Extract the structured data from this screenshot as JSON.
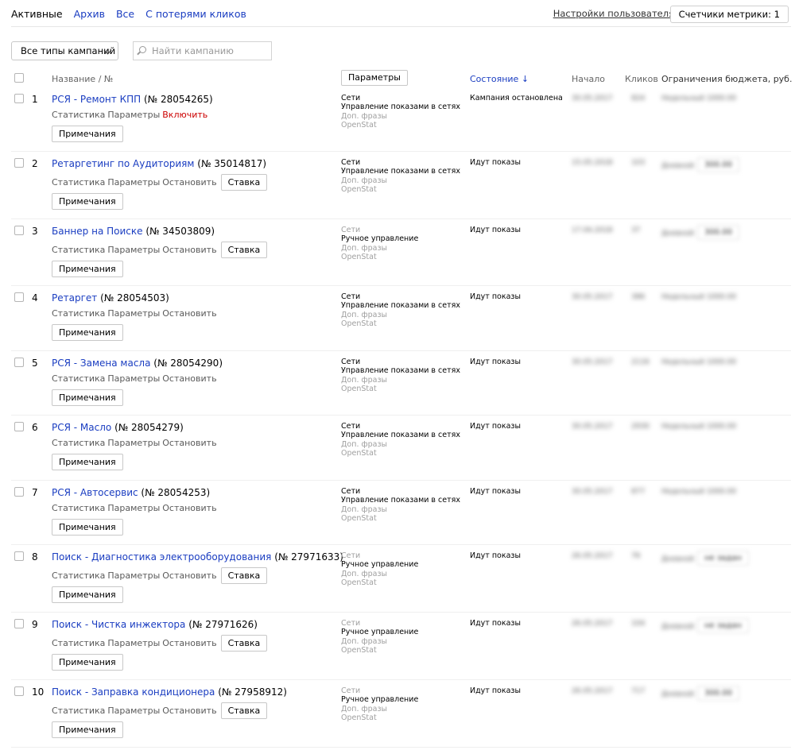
{
  "tabs": [
    {
      "label": "Активные",
      "active": true
    },
    {
      "label": "Архив"
    },
    {
      "label": "Все"
    },
    {
      "label": "С потерями кликов"
    }
  ],
  "header_right": {
    "user_settings": "Настройки пользователя",
    "metrics": "Счетчики метрики: 1"
  },
  "filters": {
    "type_select": "Все типы кампаний",
    "search_placeholder": "Найти кампанию"
  },
  "columns": {
    "name": "Название / №",
    "params_button": "Параметры",
    "status": "Состояние ↓",
    "start": "Начало",
    "clicks": "Кликов",
    "budget": "Ограничения бюджета, руб."
  },
  "row_links": {
    "stats": "Статистика",
    "params": "Параметры",
    "stop": "Остановить",
    "enable": "Включить",
    "bid": "Ставка",
    "notes": "Примечания"
  },
  "rows": [
    {
      "num": "1",
      "name": "РСЯ - Ремонт КПП",
      "id": "(№ 28054265)",
      "p1": "Сети",
      "p2": "Управление показами в сетях",
      "p3": "Доп. фразы",
      "p4": "OpenStat",
      "status": "Кампания остановлена",
      "date": "30.05.2017",
      "clicks": "824",
      "budget": "Недельный 1000.00"
    },
    {
      "num": "2",
      "name": "Ретаргетинг по Аудиториям",
      "id": "(№ 35014817)",
      "p1": "Сети",
      "p2": "Управление показами в сетях",
      "p3": "Доп. фразы",
      "p4": "OpenStat",
      "status": "Идут показы",
      "date": "15.05.2018",
      "clicks": "103",
      "budget": "Дневной",
      "budget_box": "300.00"
    },
    {
      "num": "3",
      "name": "Баннер на Поиске",
      "id": "(№ 34503809)",
      "p1": "Сети",
      "p2": "Ручное управление",
      "p3": "Доп. фразы",
      "p4": "OpenStat",
      "status": "Идут показы",
      "date": "17.04.2018",
      "clicks": "37",
      "budget": "Дневной",
      "budget_box": "300.00"
    },
    {
      "num": "4",
      "name": "Ретаргет",
      "id": "(№ 28054503)",
      "p1": "Сети",
      "p2": "Управление показами в сетях",
      "p3": "Доп. фразы",
      "p4": "OpenStat",
      "status": "Идут показы",
      "date": "30.05.2017",
      "clicks": "386",
      "budget": "Недельный 1000.00"
    },
    {
      "num": "5",
      "name": "РСЯ - Замена масла",
      "id": "(№ 28054290)",
      "p1": "Сети",
      "p2": "Управление показами в сетях",
      "p3": "Доп. фразы",
      "p4": "OpenStat",
      "status": "Идут показы",
      "date": "30.05.2017",
      "clicks": "2116",
      "budget": "Недельный 1000.00"
    },
    {
      "num": "6",
      "name": "РСЯ - Масло",
      "id": "(№ 28054279)",
      "p1": "Сети",
      "p2": "Управление показами в сетях",
      "p3": "Доп. фразы",
      "p4": "OpenStat",
      "status": "Идут показы",
      "date": "30.05.2017",
      "clicks": "2930",
      "budget": "Недельный 1000.00"
    },
    {
      "num": "7",
      "name": "РСЯ - Автосервис",
      "id": "(№ 28054253)",
      "p1": "Сети",
      "p2": "Управление показами в сетях",
      "p3": "Доп. фразы",
      "p4": "OpenStat",
      "status": "Идут показы",
      "date": "30.05.2017",
      "clicks": "877",
      "budget": "Недельный 1000.00"
    },
    {
      "num": "8",
      "name": "Поиск - Диагностика электрооборудования",
      "id": "(№ 27971633)",
      "p1": "Сети",
      "p2": "Ручное управление",
      "p3": "Доп. фразы",
      "p4": "OpenStat",
      "status": "Идут показы",
      "date": "26.05.2017",
      "clicks": "76",
      "budget": "Дневной",
      "budget_box": "не задан"
    },
    {
      "num": "9",
      "name": "Поиск - Чистка инжектора",
      "id": "(№ 27971626)",
      "p1": "Сети",
      "p2": "Ручное управление",
      "p3": "Доп. фразы",
      "p4": "OpenStat",
      "status": "Идут показы",
      "date": "26.05.2017",
      "clicks": "104",
      "budget": "Дневной",
      "budget_box": "не задан"
    },
    {
      "num": "10",
      "name": "Поиск - Заправка кондиционера",
      "id": "(№ 27958912)",
      "p1": "Сети",
      "p2": "Ручное управление",
      "p3": "Доп. фразы",
      "p4": "OpenStat",
      "status": "Идут показы",
      "date": "26.05.2017",
      "clicks": "717",
      "budget": "Дневной",
      "budget_box": "300.00"
    }
  ]
}
